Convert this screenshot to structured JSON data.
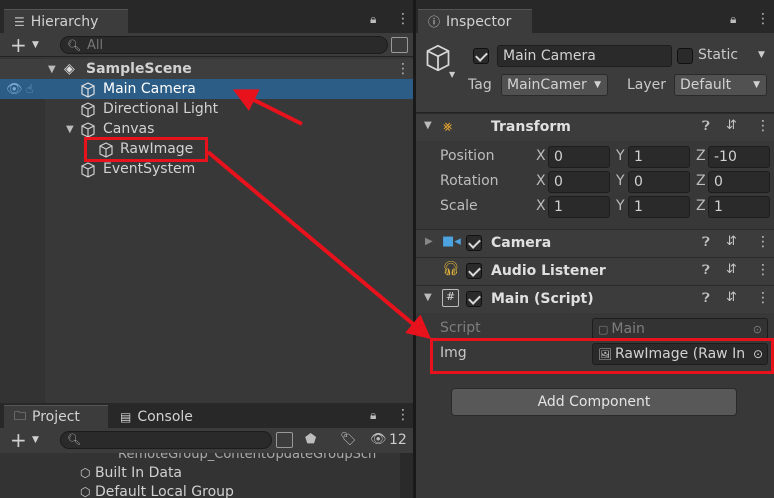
{
  "hierarchy": {
    "tab_label": "Hierarchy",
    "search_placeholder": "All",
    "scene_name": "SampleScene",
    "items": [
      "Main Camera",
      "Directional Light",
      "Canvas",
      "RawImage",
      "EventSystem"
    ]
  },
  "project": {
    "tabs": [
      "Project",
      "Console"
    ],
    "hidden_count": "12",
    "items": [
      "RemoteGroup_ContentUpdateGroupSch",
      "Built In Data",
      "Default Local Group"
    ]
  },
  "inspector": {
    "tab_label": "Inspector",
    "object_name": "Main Camera",
    "static_label": "Static",
    "tag_label": "Tag",
    "tag_value": "MainCamer",
    "layer_label": "Layer",
    "layer_value": "Default",
    "transform": {
      "title": "Transform",
      "rows": [
        {
          "label": "Position",
          "x": "0",
          "y": "1",
          "z": "-10"
        },
        {
          "label": "Rotation",
          "x": "0",
          "y": "0",
          "z": "0"
        },
        {
          "label": "Scale",
          "x": "1",
          "y": "1",
          "z": "1"
        }
      ]
    },
    "components": [
      "Camera",
      "Audio Listener",
      "Main (Script)"
    ],
    "script_label": "Script",
    "script_value": "Main",
    "img_label": "Img",
    "img_value": "RawImage (Raw In",
    "add_component": "Add Component"
  },
  "axis_labels": {
    "x": "X",
    "y": "Y",
    "z": "Z"
  },
  "colors": {
    "selection": "#2c5d87",
    "annotation": "#e8121c",
    "panel": "#383838",
    "header": "#3c3c3c"
  }
}
